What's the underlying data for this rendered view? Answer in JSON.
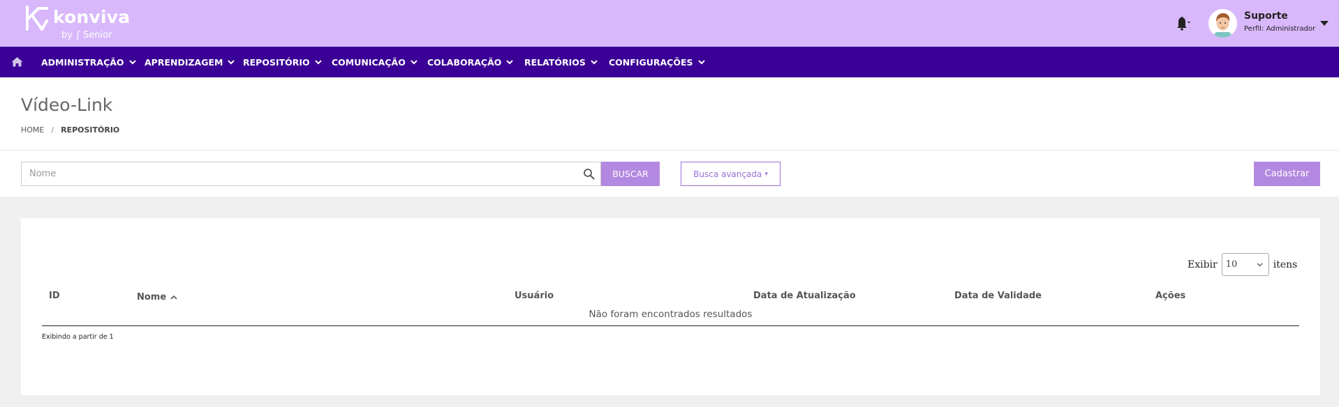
{
  "header": {
    "brand": "konviva",
    "by_line": "by ∫ Senior",
    "notifications_icon": "bell-icon",
    "user": {
      "name": "Suporte",
      "profile": "Perfil: Administrador"
    }
  },
  "nav": {
    "home_icon": "home-icon",
    "items": [
      {
        "label": "ADMINISTRAÇÃO"
      },
      {
        "label": "APRENDIZAGEM"
      },
      {
        "label": "REPOSITÓRIO"
      },
      {
        "label": "COMUNICAÇÃO"
      },
      {
        "label": "COLABORAÇÃO"
      },
      {
        "label": "RELATÓRIOS"
      },
      {
        "label": "CONFIGURAÇÕES"
      }
    ]
  },
  "page": {
    "title": "Vídeo-Link",
    "breadcrumb": {
      "home": "HOME",
      "separator": "/",
      "current": "REPOSITÓRIO"
    }
  },
  "search": {
    "placeholder": "Nome",
    "value": "",
    "search_button": "BUSCAR",
    "advanced_button": "Busca avançada",
    "advanced_caret": "▾",
    "create_button": "Cadastrar"
  },
  "table": {
    "page_size_label": "Exibir",
    "page_size_value": "10",
    "page_size_suffix": "itens",
    "columns": [
      {
        "label": "ID"
      },
      {
        "label": "Nome",
        "sorted": "ascending"
      },
      {
        "label": "Usuário"
      },
      {
        "label": "Data de Atualização"
      },
      {
        "label": "Data de Validade"
      },
      {
        "label": "Ações"
      }
    ],
    "empty_message": "Não foram encontrados resultados",
    "footer": "Exibindo a partir de 1"
  },
  "colors": {
    "header_bg": "#d8b8fb",
    "nav_bg": "#3b0095",
    "accent": "#b388e0",
    "outline_accent": "#9a6fd6"
  }
}
